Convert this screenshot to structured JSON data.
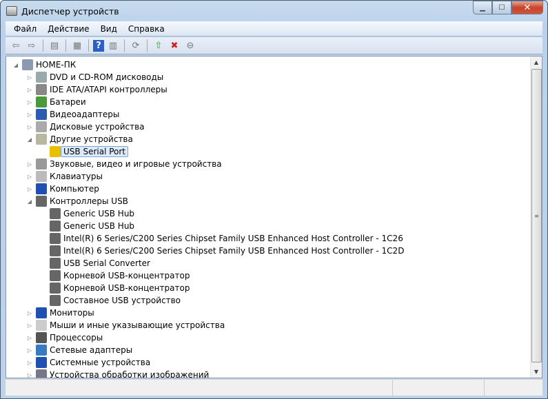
{
  "window": {
    "title": "Диспетчер устройств",
    "minimize": "▁",
    "maximize": "☐",
    "close": "✕"
  },
  "menu": [
    "Файл",
    "Действие",
    "Вид",
    "Справка"
  ],
  "toolbar": [
    {
      "icon": "back-icon",
      "g": "⇦"
    },
    {
      "icon": "forward-icon",
      "g": "⇨"
    },
    {
      "sep": true
    },
    {
      "icon": "show-hide-console-tree-icon",
      "g": "▤"
    },
    {
      "sep": true
    },
    {
      "icon": "properties-icon",
      "g": "▦"
    },
    {
      "sep": true
    },
    {
      "icon": "help-icon",
      "g": "?"
    },
    {
      "icon": "show-action-pane-icon",
      "g": "▥"
    },
    {
      "sep": true
    },
    {
      "icon": "scan-hardware-icon",
      "g": "⟳"
    },
    {
      "sep": true
    },
    {
      "icon": "update-driver-icon",
      "g": "⇧"
    },
    {
      "icon": "uninstall-icon",
      "g": "✖"
    },
    {
      "icon": "disable-device-icon",
      "g": "⊖"
    }
  ],
  "tree": [
    {
      "level": 0,
      "exp": "open",
      "label": "HOME-ПК",
      "icon": "computer-icon",
      "color": "#8c9bb0"
    },
    {
      "level": 1,
      "exp": "closed",
      "label": "DVD и CD-ROM дисководы",
      "icon": "dvd-icon",
      "color": "#9aa"
    },
    {
      "level": 1,
      "exp": "closed",
      "label": "IDE ATA/ATAPI контроллеры",
      "icon": "ide-controller-icon",
      "color": "#888"
    },
    {
      "level": 1,
      "exp": "closed",
      "label": "Батареи",
      "icon": "battery-icon",
      "color": "#4a9a3a"
    },
    {
      "level": 1,
      "exp": "closed",
      "label": "Видеоадаптеры",
      "icon": "display-adapter-icon",
      "color": "#2a5db0"
    },
    {
      "level": 1,
      "exp": "closed",
      "label": "Дисковые устройства",
      "icon": "disk-drive-icon",
      "color": "#aaa"
    },
    {
      "level": 1,
      "exp": "open",
      "label": "Другие устройства",
      "icon": "other-devices-icon",
      "color": "#b8b8a0"
    },
    {
      "level": 2,
      "exp": "none",
      "label": "USB Serial Port",
      "icon": "warning-device-icon",
      "color": "#e8c000",
      "selected": true
    },
    {
      "level": 1,
      "exp": "closed",
      "label": "Звуковые, видео и игровые устройства",
      "icon": "speaker-icon",
      "color": "#999"
    },
    {
      "level": 1,
      "exp": "closed",
      "label": "Клавиатуры",
      "icon": "keyboard-icon",
      "color": "#bbb"
    },
    {
      "level": 1,
      "exp": "closed",
      "label": "Компьютер",
      "icon": "computer-monitor-icon",
      "color": "#1f4fb0"
    },
    {
      "level": 1,
      "exp": "open",
      "label": "Контроллеры USB",
      "icon": "usb-icon",
      "color": "#666"
    },
    {
      "level": 2,
      "exp": "none",
      "label": "Generic USB Hub",
      "icon": "usb-icon",
      "color": "#666"
    },
    {
      "level": 2,
      "exp": "none",
      "label": "Generic USB Hub",
      "icon": "usb-icon",
      "color": "#666"
    },
    {
      "level": 2,
      "exp": "none",
      "label": "Intel(R) 6 Series/C200 Series Chipset Family USB Enhanced Host Controller - 1C26",
      "icon": "usb-icon",
      "color": "#666"
    },
    {
      "level": 2,
      "exp": "none",
      "label": "Intel(R) 6 Series/C200 Series Chipset Family USB Enhanced Host Controller - 1C2D",
      "icon": "usb-icon",
      "color": "#666"
    },
    {
      "level": 2,
      "exp": "none",
      "label": "USB Serial Converter",
      "icon": "usb-icon",
      "color": "#666"
    },
    {
      "level": 2,
      "exp": "none",
      "label": "Корневой USB-концентратор",
      "icon": "usb-icon",
      "color": "#666"
    },
    {
      "level": 2,
      "exp": "none",
      "label": "Корневой USB-концентратор",
      "icon": "usb-icon",
      "color": "#666"
    },
    {
      "level": 2,
      "exp": "none",
      "label": "Составное USB устройство",
      "icon": "usb-icon",
      "color": "#666"
    },
    {
      "level": 1,
      "exp": "closed",
      "label": "Мониторы",
      "icon": "monitor-icon",
      "color": "#1f4fb0"
    },
    {
      "level": 1,
      "exp": "closed",
      "label": "Мыши и иные указывающие устройства",
      "icon": "mouse-icon",
      "color": "#ccc"
    },
    {
      "level": 1,
      "exp": "closed",
      "label": "Процессоры",
      "icon": "processor-icon",
      "color": "#555"
    },
    {
      "level": 1,
      "exp": "closed",
      "label": "Сетевые адаптеры",
      "icon": "network-adapter-icon",
      "color": "#3a7ac0"
    },
    {
      "level": 1,
      "exp": "closed",
      "label": "Системные устройства",
      "icon": "system-devices-icon",
      "color": "#1f4fb0"
    },
    {
      "level": 1,
      "exp": "closed",
      "label": "Устройства обработки изображений",
      "icon": "imaging-device-icon",
      "color": "#778"
    }
  ],
  "scrollbar": {
    "up": "▲",
    "down": "▼",
    "grip": "≡"
  }
}
